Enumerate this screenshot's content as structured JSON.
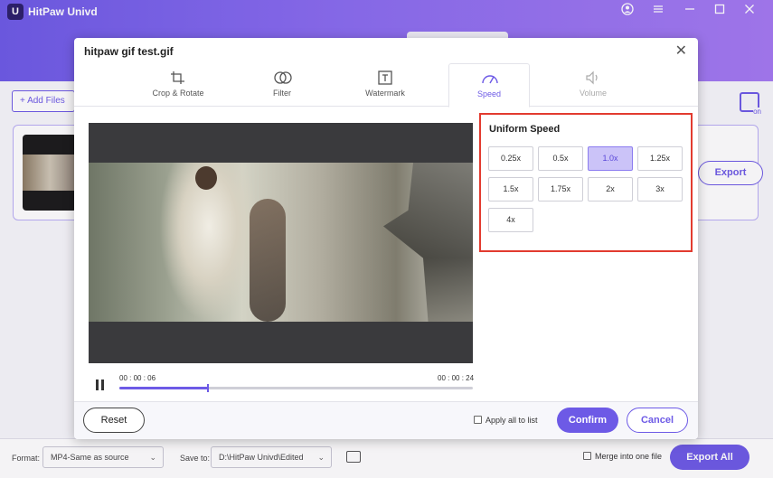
{
  "app": {
    "title": "HitPaw Univd",
    "logo_glyph": "U",
    "icons": [
      "user-icon",
      "menu-icon",
      "minimize-icon",
      "maximize-icon",
      "close-icon"
    ]
  },
  "main": {
    "add_files_label": "Add Files",
    "export_label": "Export"
  },
  "dialog": {
    "title": "hitpaw gif test.gif",
    "tabs": [
      {
        "label": "Crop & Rotate",
        "icon": "crop-icon",
        "state": "normal"
      },
      {
        "label": "Filter",
        "icon": "filter-icon",
        "state": "normal"
      },
      {
        "label": "Watermark",
        "icon": "watermark-icon",
        "state": "normal"
      },
      {
        "label": "Speed",
        "icon": "speed-gauge-icon",
        "state": "active"
      },
      {
        "label": "Volume",
        "icon": "volume-icon",
        "state": "disabled"
      }
    ],
    "player": {
      "current_time": "00 : 00 : 06",
      "total_time": "00 : 00 : 24",
      "progress": 0.25
    },
    "speed": {
      "title": "Uniform Speed",
      "options": [
        "0.25x",
        "0.5x",
        "1.0x",
        "1.25x",
        "1.5x",
        "1.75x",
        "2x",
        "3x",
        "4x"
      ],
      "selected": "1.0x"
    },
    "footer": {
      "reset_label": "Reset",
      "apply_all_label": "Apply all to list",
      "confirm_label": "Confirm",
      "cancel_label": "Cancel"
    }
  },
  "footer": {
    "format_label": "Format:",
    "format_value": "MP4-Same as source",
    "save_to_label": "Save to:",
    "save_to_value": "D:\\HitPaw Univd\\Edited",
    "merge_label": "Merge into one file",
    "export_all_label": "Export All"
  },
  "colors": {
    "accent": "#6d5ae6",
    "highlight_border": "#e23b2f",
    "selected_fill": "#cbc3f8"
  }
}
